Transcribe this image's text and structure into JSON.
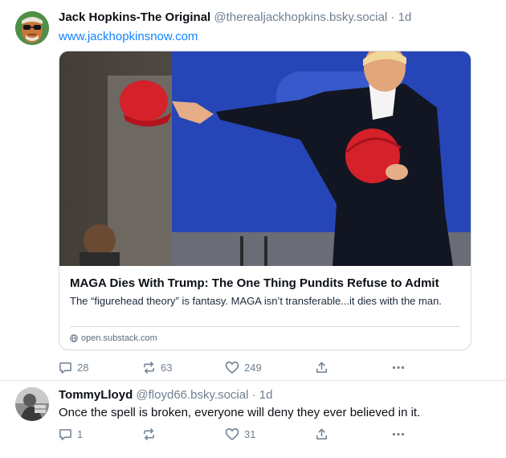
{
  "posts": [
    {
      "author_name": "Jack Hopkins-The Original",
      "handle": "@therealjackhopkins.bsky.social",
      "separator": "·",
      "time": "1d",
      "text": "www.jackhopkinsnow.com",
      "avatar_icon": "sunglasses-portrait-avatar",
      "card": {
        "title": "MAGA Dies With Trump: The One Thing Pundits Refuse to Admit",
        "description": "The “figurehead theory” is fantasy. MAGA isn’t transferable...it dies with the man.",
        "domain": "open.substack.com",
        "domain_icon": "globe-icon"
      },
      "actions": {
        "reply_count": "28",
        "repost_count": "63",
        "like_count": "249"
      }
    },
    {
      "author_name": "TommyLloyd",
      "handle": "@floyd66.bsky.social",
      "separator": "·",
      "time": "1d",
      "text": "Once the spell is broken, everyone will deny they ever believed in it.",
      "avatar_icon": "black-and-white-photo-avatar",
      "actions": {
        "reply_count": "1",
        "repost_count": "",
        "like_count": "31"
      }
    }
  ],
  "colors": {
    "link": "#1083fe",
    "muted": "#6f7f90",
    "border": "#d4dbe2"
  }
}
